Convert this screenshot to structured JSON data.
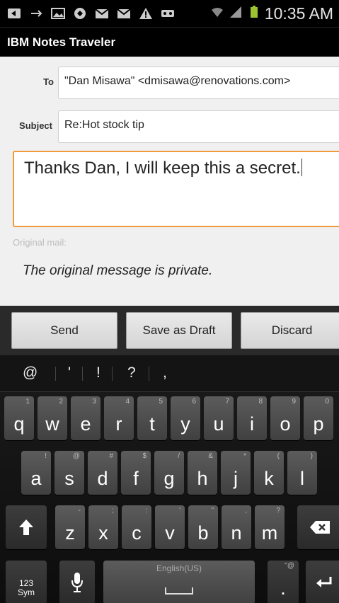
{
  "status_bar": {
    "time": "10:35 AM",
    "left_icons": [
      "back-icon",
      "usb-icon",
      "image-icon",
      "lock-icon",
      "gmail-icon",
      "mail-icon",
      "warning-icon",
      "voicemail-icon"
    ],
    "right_icons": [
      "wifi-icon",
      "signal-icon",
      "battery-icon"
    ]
  },
  "app": {
    "title": "IBM Notes Traveler"
  },
  "compose": {
    "to_label": "To",
    "to_value": "\"Dan Misawa\" <dmisawa@renovations.com>",
    "subject_label": "Subject",
    "subject_value": "Re:Hot stock tip",
    "body": "Thanks Dan, I will keep this a secret.",
    "original_label": "Original mail:",
    "original_text": "The original message is private."
  },
  "actions": {
    "send": "Send",
    "save_draft": "Save as Draft",
    "discard": "Discard"
  },
  "keyboard": {
    "suggestions": [
      "@",
      "'",
      "!",
      "?",
      ","
    ],
    "row1": [
      {
        "k": "q",
        "s": "1"
      },
      {
        "k": "w",
        "s": "2"
      },
      {
        "k": "e",
        "s": "3"
      },
      {
        "k": "r",
        "s": "4"
      },
      {
        "k": "t",
        "s": "5"
      },
      {
        "k": "y",
        "s": "6"
      },
      {
        "k": "u",
        "s": "7"
      },
      {
        "k": "i",
        "s": "8"
      },
      {
        "k": "o",
        "s": "9"
      },
      {
        "k": "p",
        "s": "0"
      }
    ],
    "row2": [
      {
        "k": "a",
        "s": "!"
      },
      {
        "k": "s",
        "s": "@"
      },
      {
        "k": "d",
        "s": "#"
      },
      {
        "k": "f",
        "s": "$"
      },
      {
        "k": "g",
        "s": "/"
      },
      {
        "k": "h",
        "s": "&"
      },
      {
        "k": "j",
        "s": "*"
      },
      {
        "k": "k",
        "s": "("
      },
      {
        "k": "l",
        "s": ")"
      }
    ],
    "row3": [
      {
        "k": "z",
        "s": "-"
      },
      {
        "k": "x",
        "s": ";"
      },
      {
        "k": "c",
        "s": ":"
      },
      {
        "k": "v",
        "s": "'"
      },
      {
        "k": "b",
        "s": "\""
      },
      {
        "k": "n",
        "s": ","
      },
      {
        "k": "m",
        "s": "?"
      }
    ],
    "sym_key": "123\nSym",
    "space_label": "English(US)",
    "period_key": ".",
    "period_sub": "\"@"
  },
  "colors": {
    "focus_border": "#f09a3a",
    "background": "#f0f0f0"
  }
}
